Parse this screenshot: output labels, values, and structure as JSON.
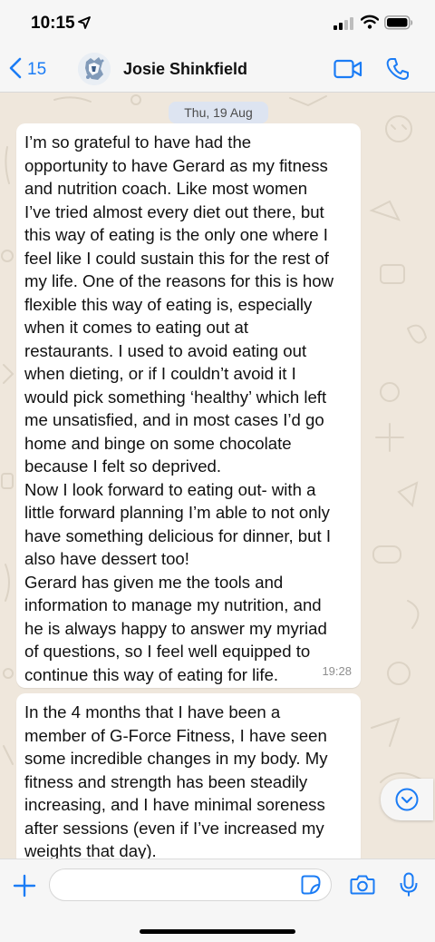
{
  "status_bar": {
    "time": "10:15"
  },
  "header": {
    "back_count": "15",
    "contact_name": "Josie Shinkfield"
  },
  "chat": {
    "date_separator": "Thu, 19 Aug",
    "messages": [
      {
        "lines": [
          "I’m so grateful to have had the",
          "opportunity to have Gerard as my fitness",
          "and nutrition coach. Like most women",
          "I’ve tried almost every diet out there, but",
          "this way of eating is the only one where I",
          "feel like I could sustain this for the rest of",
          "my life. One of the reasons for this is how",
          "flexible this way of eating is, especially",
          "when it comes to eating out at",
          "restaurants. I used to avoid eating out",
          "when dieting, or if I couldn’t avoid it I",
          "would pick something ‘healthy’ which left",
          "me unsatisfied, and in most cases I’d go",
          "home and binge on some chocolate",
          "because I felt so deprived.",
          "Now I look forward to eating out- with a",
          "little forward planning I’m able to not only",
          "have something delicious for dinner, but I",
          "also have dessert too!",
          "Gerard has given me the tools and",
          "information to manage my nutrition, and",
          "he is always happy to answer my myriad",
          "of questions, so I feel well equipped to",
          "continue this way of eating for life."
        ],
        "time": "19:28"
      },
      {
        "lines": [
          "In the 4 months that I have been a",
          "member of G-Force Fitness, I have seen",
          "some incredible changes in my body. My",
          "fitness and strength has been steadily",
          "increasing, and I have minimal soreness",
          "after sessions (even if I’ve increased my",
          "weights that day)."
        ]
      }
    ]
  },
  "input_bar": {
    "message_value": "",
    "message_placeholder": ""
  },
  "colors": {
    "accent": "#1b7cf5",
    "chat_background": "#efe7dc",
    "bubble": "#ffffff",
    "date_pill": "#dde4f1"
  },
  "icons": {
    "status": [
      "location-arrow-icon",
      "signal-icon",
      "wifi-icon",
      "battery-icon"
    ],
    "header": [
      "back-chevron-icon",
      "video-call-icon",
      "phone-icon"
    ],
    "input": [
      "plus-icon",
      "sticker-icon",
      "camera-icon",
      "microphone-icon"
    ],
    "chat": [
      "chevron-down-icon"
    ]
  }
}
